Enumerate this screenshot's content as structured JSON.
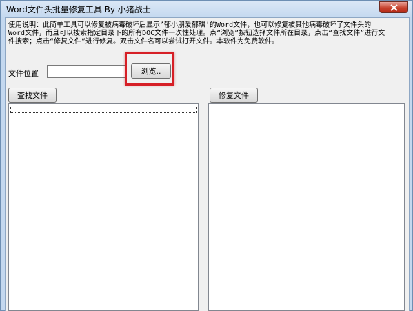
{
  "window": {
    "title": "Word文件头批量修复工具  By 小猪战士",
    "close_icon": "close-icon"
  },
  "instructions": "使用说明：此简单工具可以修复被病毒破坏后显示’郁小朋爱郁琪’的Word文件，也可以修复被其他病毒破坏了文件头的\nWord文件，而且可以搜索指定目录下的所有DOC文件一次性处理。点“浏览”按钮选择文件所在目录，点击“查找文件”进行文\n件搜索；点击“修复文件”进行修复。双击文件名可以尝试打开文件。本软件为免费软件。",
  "location": {
    "label": "文件位置",
    "path_value": "",
    "browse_label": "浏览.."
  },
  "buttons": {
    "find_label": "查找文件",
    "repair_label": "修复文件"
  },
  "colors": {
    "highlight": "#d61f26"
  }
}
